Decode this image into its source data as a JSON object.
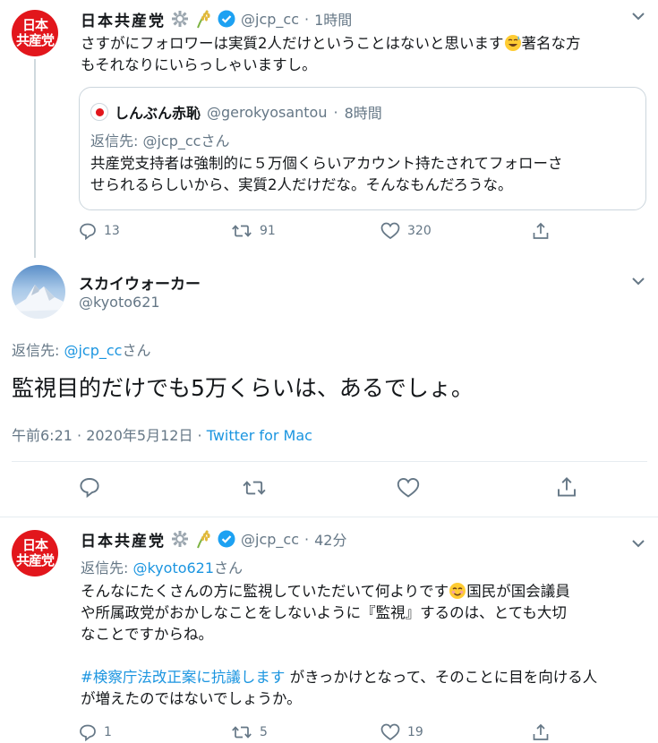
{
  "tweet1": {
    "author_name": "日本共産党",
    "handle": "@jcp_cc",
    "dot": "·",
    "time": "1時間",
    "text_line1": "さすがにフォロワーは実質2人だけということはないと思います",
    "text_after_emoji": "著名な方",
    "text_line2": "もそれなりにいらっしゃいますし。",
    "replies": "13",
    "retweets": "91",
    "likes": "320",
    "quote": {
      "author_name": "しんぶん赤恥",
      "handle": "@gerokyosantou",
      "dot": "·",
      "time": "8時間",
      "reply_prefix": "返信先: ",
      "reply_to": "@jcp_ccさん",
      "text_line1": "共産党支持者は強制的に５万個くらいアカウント持たされてフォローさ",
      "text_line2": "せられるらしいから、実質2人だけだな。そんなもんだろうな。"
    }
  },
  "avatar_text": {
    "line1": "日本",
    "line2": "共産党"
  },
  "main": {
    "author_name": "スカイウォーカー",
    "handle": "@kyoto621",
    "reply_prefix": "返信先: ",
    "reply_to": "@jcp_cc",
    "reply_suffix": "さん",
    "text": "監視目的だけでも5万くらいは、あるでしょ。",
    "timestamp": "午前6:21 · 2020年5月12日 · ",
    "source": "Twitter for Mac"
  },
  "tweet3": {
    "author_name": "日本共産党",
    "handle": "@jcp_cc",
    "dot": "·",
    "time": "42分",
    "reply_prefix": "返信先: ",
    "reply_to": "@kyoto621",
    "reply_suffix": "さん",
    "text_line1a": "そんなにたくさんの方に監視していただいて何よりです",
    "text_line1b": "国民が国会議員",
    "text_line2": "や所属政党がおかしなことをしないように『監視』するのは、とても大切",
    "text_line3": "なことですからね。",
    "hashtag": "#検察庁法改正案に抗議します",
    "text_line4": " がきっかけとなって、そのことに目を向ける人",
    "text_line5": "が増えたのではないでしょうか。",
    "replies": "1",
    "retweets": "5",
    "likes": "19"
  },
  "colors": {
    "brand_red": "#e2161c",
    "link_blue": "#1b95e0",
    "verified_blue": "#1da1f2",
    "grey": "#657786"
  }
}
